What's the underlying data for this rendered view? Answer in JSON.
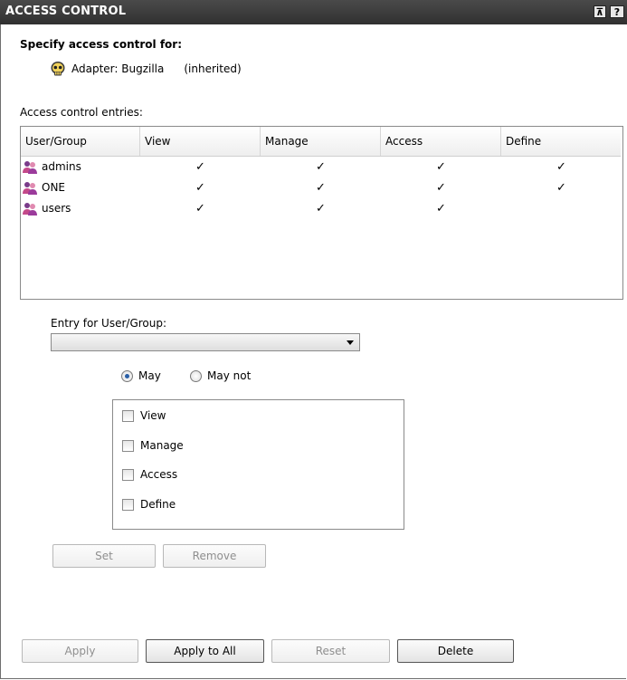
{
  "window": {
    "title": "ACCESS CONTROL",
    "pin_label": "⊼",
    "help_label": "?"
  },
  "spec": {
    "label": "Specify access control for:",
    "adapter": "Adapter: Bugzilla",
    "inherited": "(inherited)"
  },
  "table": {
    "label": "Access control entries:",
    "columns": [
      "User/Group",
      "View",
      "Manage",
      "Access",
      "Define"
    ],
    "rows": [
      {
        "name": "admins",
        "view": "✓",
        "manage": "✓",
        "access": "✓",
        "define": "✓"
      },
      {
        "name": "ONE",
        "view": "✓",
        "manage": "✓",
        "access": "✓",
        "define": "✓"
      },
      {
        "name": "users",
        "view": "✓",
        "manage": "✓",
        "access": "✓",
        "define": ""
      }
    ]
  },
  "entry": {
    "label": "Entry for User/Group:",
    "selected": ""
  },
  "mode": {
    "may": "May",
    "may_not": "May not",
    "selected": "May"
  },
  "permissions": [
    "View",
    "Manage",
    "Access",
    "Define"
  ],
  "buttons": {
    "set": "Set",
    "remove": "Remove",
    "apply": "Apply",
    "apply_all": "Apply to All",
    "reset": "Reset",
    "delete": "Delete"
  }
}
